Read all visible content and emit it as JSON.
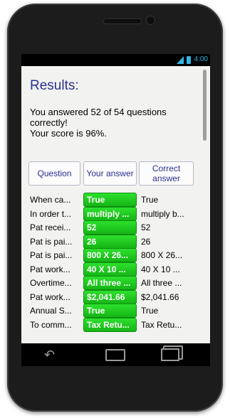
{
  "status": {
    "time": "4:00"
  },
  "results": {
    "title": "Results:",
    "message": "You answered 52 of 54 questions correctly!\nYour score is 96%."
  },
  "table": {
    "headers": [
      "Question",
      "Your answer",
      "Correct answer"
    ],
    "rows": [
      {
        "question": "When ca...",
        "your_answer": "True",
        "correct_answer": "True"
      },
      {
        "question": "In order t...",
        "your_answer": "multiply ...",
        "correct_answer": "multiply b..."
      },
      {
        "question": "Pat recei...",
        "your_answer": "52",
        "correct_answer": "52"
      },
      {
        "question": "Pat is pai...",
        "your_answer": "26",
        "correct_answer": "26"
      },
      {
        "question": "Pat is pai...",
        "your_answer": "800 X 26...",
        "correct_answer": "800 X 26..."
      },
      {
        "question": "Pat work...",
        "your_answer": "40 X 10 ...",
        "correct_answer": "40 X 10 ..."
      },
      {
        "question": "Overtime...",
        "your_answer": "All three ...",
        "correct_answer": "All three ..."
      },
      {
        "question": "Pat work...",
        "your_answer": "$2,041.66",
        "correct_answer": "$2,041.66"
      },
      {
        "question": "Annual S...",
        "your_answer": "True",
        "correct_answer": "True"
      },
      {
        "question": "To comm...",
        "your_answer": "Tax Retu...",
        "correct_answer": "Tax Retu..."
      }
    ]
  },
  "icons": {
    "signal": "signal-icon",
    "battery": "battery-icon",
    "back": "back-icon",
    "home": "home-icon",
    "recent": "recent-apps-icon"
  },
  "colors": {
    "correct": "#22cc22",
    "heading": "#2b2f8f",
    "status": "#33b5e5"
  }
}
